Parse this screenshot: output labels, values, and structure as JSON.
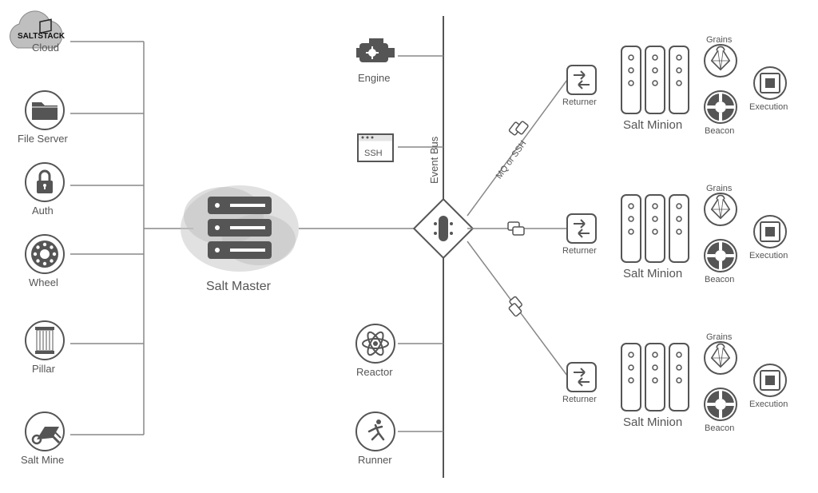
{
  "left_items": [
    {
      "id": "cloud",
      "icon": "cloud",
      "label": "",
      "sublabel": "Cloud",
      "brand": "SALTSTACK"
    },
    {
      "id": "file-server",
      "icon": "folder",
      "label": "File Server"
    },
    {
      "id": "auth",
      "icon": "lock",
      "label": "Auth"
    },
    {
      "id": "wheel",
      "icon": "gear-wheel",
      "label": "Wheel"
    },
    {
      "id": "pillar",
      "icon": "column",
      "label": "Pillar"
    },
    {
      "id": "salt-mine",
      "icon": "wheelbarrow",
      "label": "Salt Mine"
    }
  ],
  "master": {
    "label": "Salt Master"
  },
  "bus": {
    "label": "Event Bus",
    "transport": "MQ or SSH"
  },
  "bus_items": [
    {
      "id": "engine",
      "icon": "engine",
      "label": "Engine"
    },
    {
      "id": "ssh",
      "icon": "terminal",
      "label": "",
      "text_inside": "SSH"
    },
    {
      "id": "reactor",
      "icon": "atom",
      "label": "Reactor"
    },
    {
      "id": "runner",
      "icon": "runner",
      "label": "Runner"
    }
  ],
  "minion": {
    "returner": "Returner",
    "label": "Salt Minion",
    "right": [
      {
        "id": "grains",
        "label": "Grains"
      },
      {
        "id": "beacon",
        "label": "Beacon"
      },
      {
        "id": "execution",
        "label": "Execution"
      }
    ]
  },
  "minion_count": 3
}
